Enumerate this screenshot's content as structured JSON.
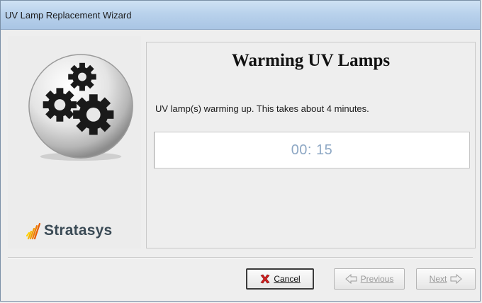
{
  "window": {
    "title": "UV Lamp Replacement Wizard"
  },
  "left_panel": {
    "brand": "Stratasys",
    "logo_icon": "gears-icon"
  },
  "content": {
    "heading": "Warming UV Lamps",
    "message": "UV lamp(s) warming up. This takes about 4 minutes.",
    "timer": "00: 15"
  },
  "buttons": {
    "cancel": "Cancel",
    "previous": "Previous",
    "next": "Next"
  },
  "colors": {
    "titlebar": "#b9d2ec",
    "timer_text": "#8da7c4",
    "cancel_icon": "#d11f1f"
  }
}
